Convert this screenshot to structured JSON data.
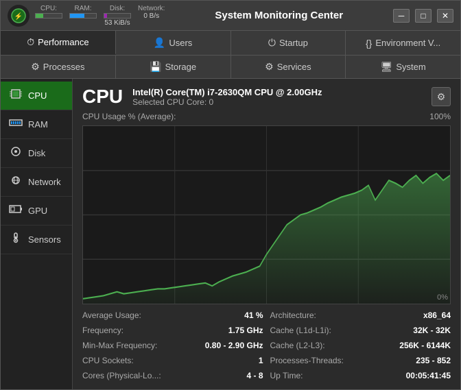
{
  "titleBar": {
    "title": "System Monitoring Center",
    "stats": {
      "cpu_label": "CPU:",
      "ram_label": "RAM:",
      "disk_label": "Disk:",
      "network_label": "Network:",
      "disk_value": "53 KiB/s",
      "network_value": "0 B/s"
    },
    "controls": {
      "minimize": "─",
      "maximize": "□",
      "close": "✕"
    }
  },
  "nav1": [
    {
      "id": "performance",
      "icon": "⏱",
      "label": "Performance",
      "active": true
    },
    {
      "id": "users",
      "icon": "👤",
      "label": "Users",
      "active": false
    },
    {
      "id": "startup",
      "icon": "⏻",
      "label": "Startup",
      "active": false
    },
    {
      "id": "environment",
      "icon": "{}",
      "label": "Environment V...",
      "active": false
    }
  ],
  "nav2": [
    {
      "id": "processes",
      "icon": "⚙",
      "label": "Processes",
      "active": false
    },
    {
      "id": "storage",
      "icon": "💾",
      "label": "Storage",
      "active": false
    },
    {
      "id": "services",
      "icon": "⚙",
      "label": "Services",
      "active": false
    },
    {
      "id": "system",
      "icon": "🖥",
      "label": "System",
      "active": false
    }
  ],
  "sidebar": {
    "items": [
      {
        "id": "cpu",
        "icon": "⬛",
        "label": "CPU",
        "active": true
      },
      {
        "id": "ram",
        "icon": "⬛",
        "label": "RAM",
        "active": false
      },
      {
        "id": "disk",
        "icon": "⬛",
        "label": "Disk",
        "active": false
      },
      {
        "id": "network",
        "icon": "⬛",
        "label": "Network",
        "active": false
      },
      {
        "id": "gpu",
        "icon": "⬛",
        "label": "GPU",
        "active": false
      },
      {
        "id": "sensors",
        "icon": "⬛",
        "label": "Sensors",
        "active": false
      }
    ]
  },
  "cpuPanel": {
    "title": "CPU",
    "processor_name": "Intel(R) Core(TM) i7-2630QM CPU @ 2.00GHz",
    "selected_core": "Selected CPU Core: 0",
    "chart_label": "CPU Usage % (Average):",
    "chart_max": "100%",
    "chart_min": "0%",
    "stats": [
      {
        "key": "Average Usage:",
        "val": "41 %"
      },
      {
        "key": "Architecture:",
        "val": "x86_64"
      },
      {
        "key": "Frequency:",
        "val": "1.75 GHz"
      },
      {
        "key": "Cache (L1d-L1i):",
        "val": "32K - 32K"
      },
      {
        "key": "Min-Max Frequency:",
        "val": "0.80 - 2.90 GHz"
      },
      {
        "key": "Cache (L2-L3):",
        "val": "256K - 6144K"
      },
      {
        "key": "CPU Sockets:",
        "val": "1"
      },
      {
        "key": "Processes-Threads:",
        "val": "235 - 852"
      },
      {
        "key": "Cores (Physical-Lo...:",
        "val": "4 - 8"
      },
      {
        "key": "Up Time:",
        "val": "00:05:41:45"
      }
    ]
  }
}
